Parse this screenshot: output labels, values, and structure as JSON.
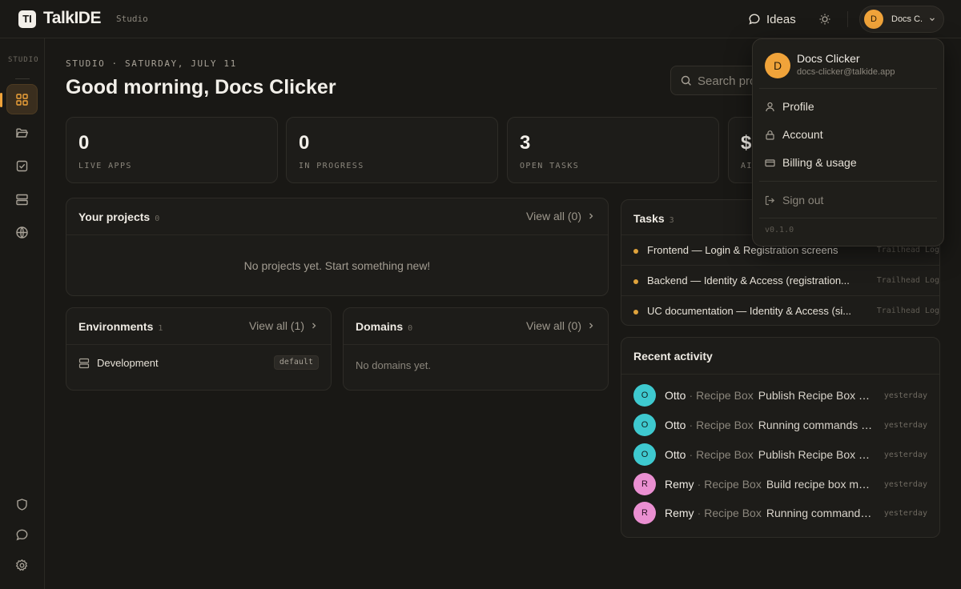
{
  "brand": {
    "mark": "TI",
    "name": "TalkIDE",
    "sub": "Studio"
  },
  "topbar": {
    "ideas_label": "Ideas",
    "user_initial": "D",
    "user_short": "Docs C."
  },
  "sidebar": {
    "label": "STUDIO"
  },
  "header": {
    "eyebrow": "STUDIO · SATURDAY, JULY 11",
    "greeting": "Good morning, Docs Clicker"
  },
  "search": {
    "placeholder": "Search pro"
  },
  "stats": [
    {
      "value": "0",
      "label": "LIVE APPS"
    },
    {
      "value": "0",
      "label": "IN PROGRESS"
    },
    {
      "value": "3",
      "label": "OPEN TASKS"
    },
    {
      "value": "$",
      "label": "AI"
    }
  ],
  "projects": {
    "title": "Your projects",
    "count": "0",
    "view_all": "View all (0)",
    "empty": "No projects yet. Start something new!"
  },
  "environments": {
    "title": "Environments",
    "count": "1",
    "view_all": "View all (1)",
    "items": [
      {
        "name": "Development",
        "badge": "default"
      }
    ]
  },
  "domains": {
    "title": "Domains",
    "count": "0",
    "view_all": "View all (0)",
    "empty": "No domains yet."
  },
  "tasks": {
    "title": "Tasks",
    "count": "3",
    "items": [
      {
        "title": "Frontend — Login & Registration screens",
        "project": "Trailhead Log"
      },
      {
        "title": "Backend — Identity & Access (registration...",
        "project": "Trailhead Log"
      },
      {
        "title": "UC documentation — Identity & Access (si...",
        "project": "Trailhead Log"
      }
    ]
  },
  "activity": {
    "title": "Recent activity",
    "items": [
      {
        "initial": "O",
        "user": "Otto",
        "project": "Recipe Box",
        "message": "Publish Recipe Box m...",
        "time": "yesterday",
        "color": "#3ec9cf"
      },
      {
        "initial": "O",
        "user": "Otto",
        "project": "Recipe Box",
        "message": "Running commands f...",
        "time": "yesterday",
        "color": "#3ec9cf"
      },
      {
        "initial": "O",
        "user": "Otto",
        "project": "Recipe Box",
        "message": "Publish Recipe Box m...",
        "time": "yesterday",
        "color": "#3ec9cf"
      },
      {
        "initial": "R",
        "user": "Remy",
        "project": "Recipe Box",
        "message": "Build recipe box mo...",
        "time": "yesterday",
        "color": "#ea8fd1"
      },
      {
        "initial": "R",
        "user": "Remy",
        "project": "Recipe Box",
        "message": "Running commands...",
        "time": "yesterday",
        "color": "#ea8fd1"
      }
    ]
  },
  "menu": {
    "name": "Docs Clicker",
    "email": "docs-clicker@talkide.app",
    "initial": "D",
    "profile": "Profile",
    "account": "Account",
    "billing": "Billing & usage",
    "signout": "Sign out",
    "version": "v0.1.0"
  },
  "colors": {
    "accent": "#f0a33a",
    "background": "#191815",
    "otto": "#3ec9cf",
    "remy": "#ea8fd1"
  }
}
